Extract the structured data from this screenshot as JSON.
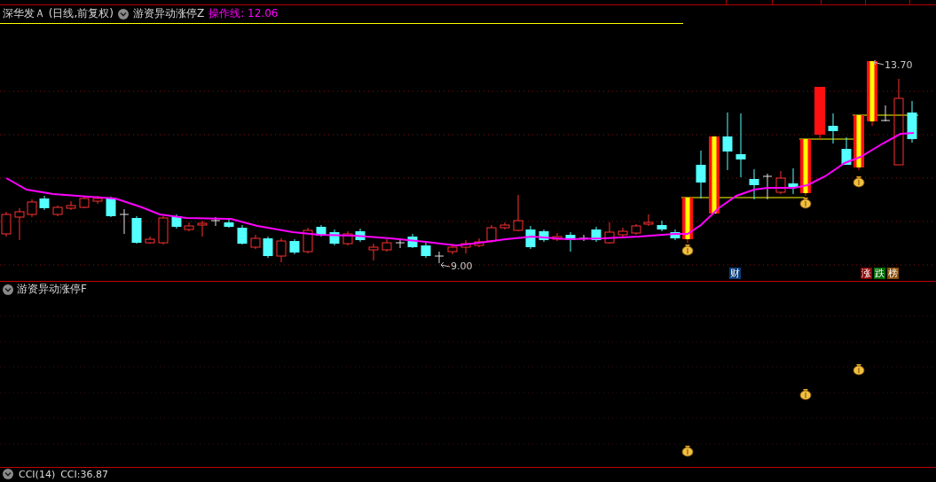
{
  "header": {
    "stock": "深华发Ａ",
    "period": "(日线,前复权)",
    "indicator": "游资异动涨停Z",
    "line_label": "操作线:",
    "line_value": "12.06"
  },
  "main_chart": {
    "high_label": "13.70",
    "low_label": "9.00",
    "badges": [
      {
        "text": "财",
        "color": "#0b3d7a"
      },
      {
        "text": "涨",
        "color": "#8b0000"
      },
      {
        "text": "跌",
        "color": "#006a00"
      },
      {
        "text": "榜",
        "color": "#8a4a00"
      }
    ]
  },
  "sub_panel": {
    "title": "游资异动涨停F"
  },
  "bottom_panel": {
    "title": "CCI(14)",
    "reading": "CCI:36.87"
  }
}
